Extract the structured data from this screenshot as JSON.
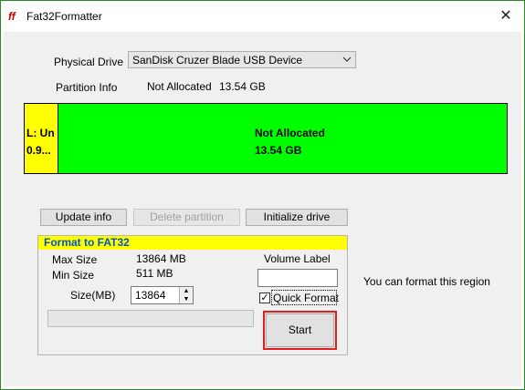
{
  "window": {
    "title": "Fat32Formatter",
    "app_icon": "fat32-app-icon",
    "close_glyph": "✕"
  },
  "drive": {
    "label": "Physical Drive",
    "selected": "SanDisk Cruzer Blade USB Device",
    "partition_info_label": "Partition Info",
    "partition_info_value": "Not Allocated",
    "partition_info_size": "13.54 GB"
  },
  "disk_map": {
    "small_partition": {
      "line1": "L: Un",
      "line2": "0.9...",
      "color": "#ffff00"
    },
    "main_partition": {
      "line1": "Not Allocated",
      "line2": "13.54 GB",
      "color": "#00ff00"
    }
  },
  "buttons": {
    "update_info": "Update info",
    "delete_partition": "Delete partition",
    "initialize_drive": "Initialize drive"
  },
  "format_group": {
    "title": "Format to FAT32",
    "max_size_label": "Max Size",
    "max_size_value": "13864 MB",
    "min_size_label": "Min Size",
    "min_size_value": "511 MB",
    "size_label": "Size(MB)",
    "size_value": "13864",
    "volume_label": "Volume Label",
    "volume_value": "",
    "quick_format_label": "Quick Format",
    "quick_format_checked": true,
    "start_label": "Start",
    "progress": 0
  },
  "hint": "You can format this region",
  "colors": {
    "accent_title": "#0055cc",
    "group_header": "#ffff00",
    "start_highlight": "#e02020"
  }
}
